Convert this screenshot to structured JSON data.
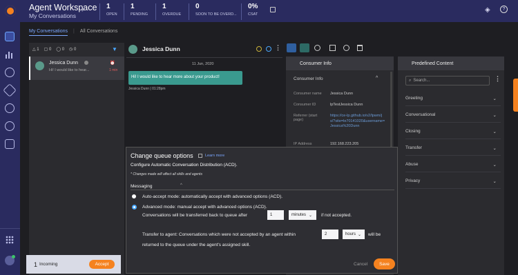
{
  "header": {
    "title": "Agent Workspace",
    "subtitle": "My Conversations",
    "stats": [
      {
        "value": "1",
        "label": "OPEN"
      },
      {
        "value": "1",
        "label": "PENDING"
      },
      {
        "value": "1",
        "label": "OVERDUE"
      },
      {
        "value": "0",
        "label": "SOON TO BE OVERD..."
      },
      {
        "value": "0%",
        "label": "CSAT"
      }
    ]
  },
  "tabs": [
    "My Conversations",
    "All Conversations"
  ],
  "filters": [
    "1",
    "0",
    "0",
    "0"
  ],
  "conversation": {
    "name": "Jessica Dunn",
    "preview": "Hi! I would like to hear...",
    "time": "1 min"
  },
  "chat": {
    "name": "Jessica Dunn",
    "date": "11 Jun, 2020",
    "message": "Hi! I would like to hear more about your product!",
    "meta": "Jessica Dunn | 01:28pm"
  },
  "consumer_panel": {
    "title": "Consumer Info",
    "section": "Consumer Info",
    "rows": [
      {
        "label": "Consumer name",
        "value": "Jessica Dunn"
      },
      {
        "label": "Consumer ID",
        "value": "lpTestJessica Dunn"
      },
      {
        "label": "Referrer (start page)",
        "value": "https://ce-lp.github.io/v2/lpwm/js/?site=le70141020&username=Jessica%20Dunn"
      },
      {
        "label": "IP Address",
        "value": "192.168.223.205"
      }
    ]
  },
  "predefined": {
    "title": "Predefined Content",
    "search_placeholder": "Search...",
    "categories": [
      "Greeting",
      "Conversational",
      "Closing",
      "Transfer",
      "Abuse",
      "Privacy"
    ]
  },
  "modal": {
    "title": "Change queue options",
    "learn_more": "Learn more",
    "subtitle": "Configure Automatic Conversation Distribution (ACD).",
    "note": "* Changes made will affect all skills and agents",
    "section": "Messaging",
    "option1": "Auto-accept mode: automatically accept with advanced options (ACD).",
    "option2": "Advanced mode: manual accept with advanced options (ACD).",
    "transfer_prefix": "Conversations will be transferred back to queue after",
    "transfer_value": "1",
    "transfer_unit": "minutes",
    "transfer_suffix": "if not accepted.",
    "agent_prefix": "Transfer to agent: Conversations which were not accepted by an agent within",
    "agent_value": "2",
    "agent_unit": "hours",
    "agent_suffix": "will be",
    "agent_line2": "returned to the queue under the agent's assigned skill.",
    "cancel": "Cancel",
    "save": "Save"
  },
  "incoming": {
    "count": "1",
    "label": "Incoming",
    "accept": "Accept"
  }
}
